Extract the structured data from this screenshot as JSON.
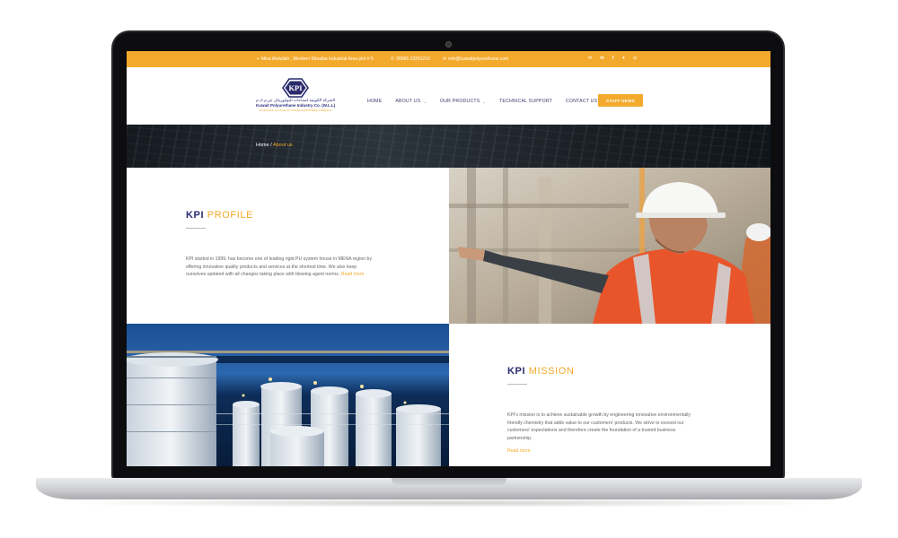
{
  "topbar": {
    "address": "Mina Abdullah , Western Shuaiba Industrial Area plot # 5",
    "phone": "00965 23261210",
    "email": "info@kuwaitpolyurethane.com",
    "socials": [
      "email-icon",
      "linkedin-icon",
      "facebook-icon",
      "twitter-icon",
      "instagram-icon"
    ]
  },
  "logo": {
    "mark": "KPI",
    "arabic": "الشركة الكويتية لصناعات البوليوريثان ش.م.ك.م",
    "english": "Kuwait Polyurethane Industry Co. (W.L.L)",
    "tagline": "AN AVANCE CLASSE OF UNITED INDUSTRIES COMPANY"
  },
  "nav": {
    "home": "HOME",
    "about": "ABOUT US",
    "products": "OUR PRODUCTS",
    "support": "TECHNICAL SUPPORT",
    "contact": "CONTACT US",
    "staff": "STAFF NEWS"
  },
  "breadcrumb": {
    "home": "Home",
    "sep": " / ",
    "current": "About us"
  },
  "profile": {
    "title_strong": "KPI",
    "title_light": "PROFILE",
    "line1": "KPI started in 1999, has become one of leading rigid PU system house in MENA region by",
    "line2": "offering innovative quality products and services at the shortest time. We also keep",
    "line3": "ourselves updated with all changes taking place with blowing agent norms.",
    "more": "Read more"
  },
  "mission": {
    "title_strong": "KPI",
    "title_light": "MISSION",
    "line1": "KPI's mission is to achieve sustainable growth by engineering innovative environmentally",
    "line2": "friendly chemistry that adds value to our customers' products. We strive to exceed our",
    "line3": "customers' expectations and therefore create the foundation of a trusted business",
    "line4": "partnership.",
    "more": "Read more"
  },
  "colors": {
    "accent": "#f3aa2c",
    "brand": "#2a2b6d"
  }
}
